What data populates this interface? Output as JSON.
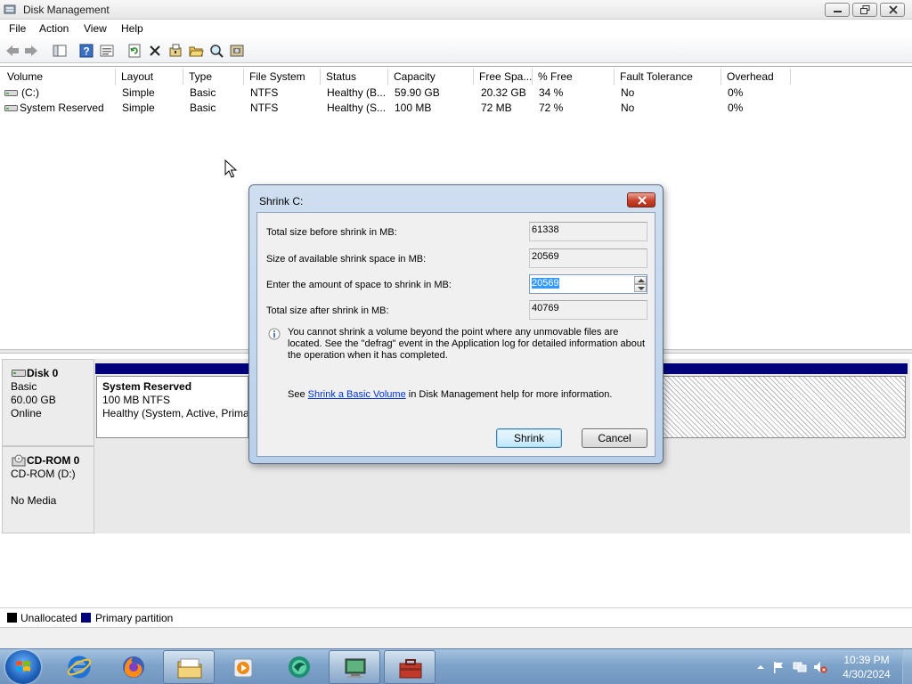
{
  "window": {
    "title": "Disk Management",
    "controls": [
      "minimize",
      "restore",
      "close"
    ]
  },
  "menu": [
    "File",
    "Action",
    "View",
    "Help"
  ],
  "toolbar_icons": [
    "back-icon",
    "forward-icon",
    "console-tree-icon",
    "help-icon",
    "properties-list-icon",
    "refresh-icon",
    "delete-icon",
    "properties-icon",
    "open-icon",
    "explore-icon",
    "rescan-disks-icon"
  ],
  "volume_table": {
    "columns": [
      "Volume",
      "Layout",
      "Type",
      "File System",
      "Status",
      "Capacity",
      "Free Spa...",
      "% Free",
      "Fault Tolerance",
      "Overhead"
    ],
    "rows": [
      [
        "(C:)",
        "Simple",
        "Basic",
        "NTFS",
        "Healthy (B...",
        "59.90 GB",
        "20.32 GB",
        "34 %",
        "No",
        "0%"
      ],
      [
        "System Reserved",
        "Simple",
        "Basic",
        "NTFS",
        "Healthy (S...",
        "100 MB",
        "72 MB",
        "72 %",
        "No",
        "0%"
      ]
    ]
  },
  "disks": {
    "disk0": {
      "name": "Disk 0",
      "type": "Basic",
      "size": "60.00 GB",
      "state": "Online",
      "partition": {
        "name": "System Reserved",
        "size_fs": "100 MB NTFS",
        "status": "Healthy (System, Active, Primar"
      }
    },
    "cdrom0": {
      "name": "CD-ROM 0",
      "drive": "CD-ROM (D:)",
      "media": "No Media"
    }
  },
  "legend": [
    {
      "label": "Unallocated",
      "color": "#000000"
    },
    {
      "label": "Primary partition",
      "color": "#00007b"
    }
  ],
  "dialog": {
    "title": "Shrink C:",
    "fields": {
      "total_before_label": "Total size before shrink in MB:",
      "total_before_value": "61338",
      "available_label": "Size of available shrink space in MB:",
      "available_value": "20569",
      "amount_label": "Enter the amount of space to shrink in MB:",
      "amount_value": "20569",
      "total_after_label": "Total size after shrink in MB:",
      "total_after_value": "40769"
    },
    "info_text": "You cannot shrink a volume beyond the point where any unmovable files are located. See the \"defrag\" event in the Application log for detailed information about the operation when it has completed.",
    "help_prefix": "See ",
    "help_link": "Shrink a Basic Volume",
    "help_suffix": " in Disk Management help for more information.",
    "shrink_button": "Shrink",
    "cancel_button": "Cancel"
  },
  "taskbar": {
    "apps": [
      "internet-explorer-icon",
      "firefox-icon",
      "file-explorer-icon",
      "media-player-icon",
      "app-green-icon",
      "computer-management-icon",
      "disk-management-icon"
    ],
    "clock_time": "10:39 PM",
    "clock_date": "4/30/2024"
  }
}
